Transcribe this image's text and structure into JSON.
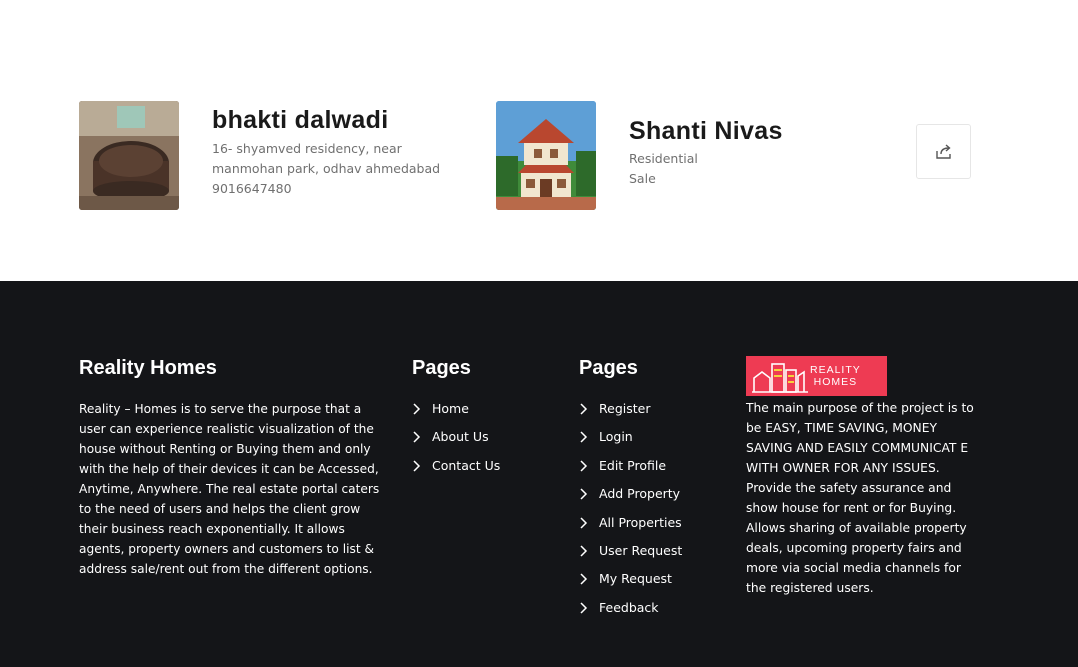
{
  "owner": {
    "name": "bhakti dalwadi",
    "address": "16- shyamved residency, near manmohan park, odhav ahmedabad",
    "phone": "9016647480",
    "photo_icon": "owner-photo"
  },
  "property": {
    "name": "Shanti Nivas",
    "type": "Residential",
    "status": "Sale",
    "photo_icon": "house-photo"
  },
  "share": {
    "icon": "share-icon"
  },
  "footer": {
    "about": {
      "title": "Reality Homes",
      "text": "Reality – Homes is to serve the purpose that a user can experience realistic visualization of the house without Renting or Buying them and only with the help of their devices it can be Accessed, Anytime, Anywhere. The real estate portal caters to the need of users and helps the client grow their business reach exponentially. It allows agents, property owners and customers to list & address sale/rent out from the different options."
    },
    "pages1": {
      "title": "Pages",
      "links": [
        "Home",
        "About Us",
        "Contact Us"
      ]
    },
    "pages2": {
      "title": "Pages",
      "links": [
        "Register",
        "Login",
        "Edit Profile",
        "Add Property",
        "All Properties",
        "User Request",
        "My Request",
        "Feedback"
      ]
    },
    "logo": {
      "line1": "REALITY",
      "line2": "HOMES",
      "color": "#ee3b53"
    },
    "description": "The main purpose of the project is to be EASY, TIME SAVING, MONEY SAVING AND EASILY COMMUNICAT E WITH OWNER FOR ANY ISSUES. Provide the safety assurance and show house for rent or for Buying. Allows sharing of available property deals, upcoming property fairs and more via social media channels for the registered users."
  },
  "colors": {
    "footer_bg": "#141518",
    "brand": "#ee3b53"
  }
}
